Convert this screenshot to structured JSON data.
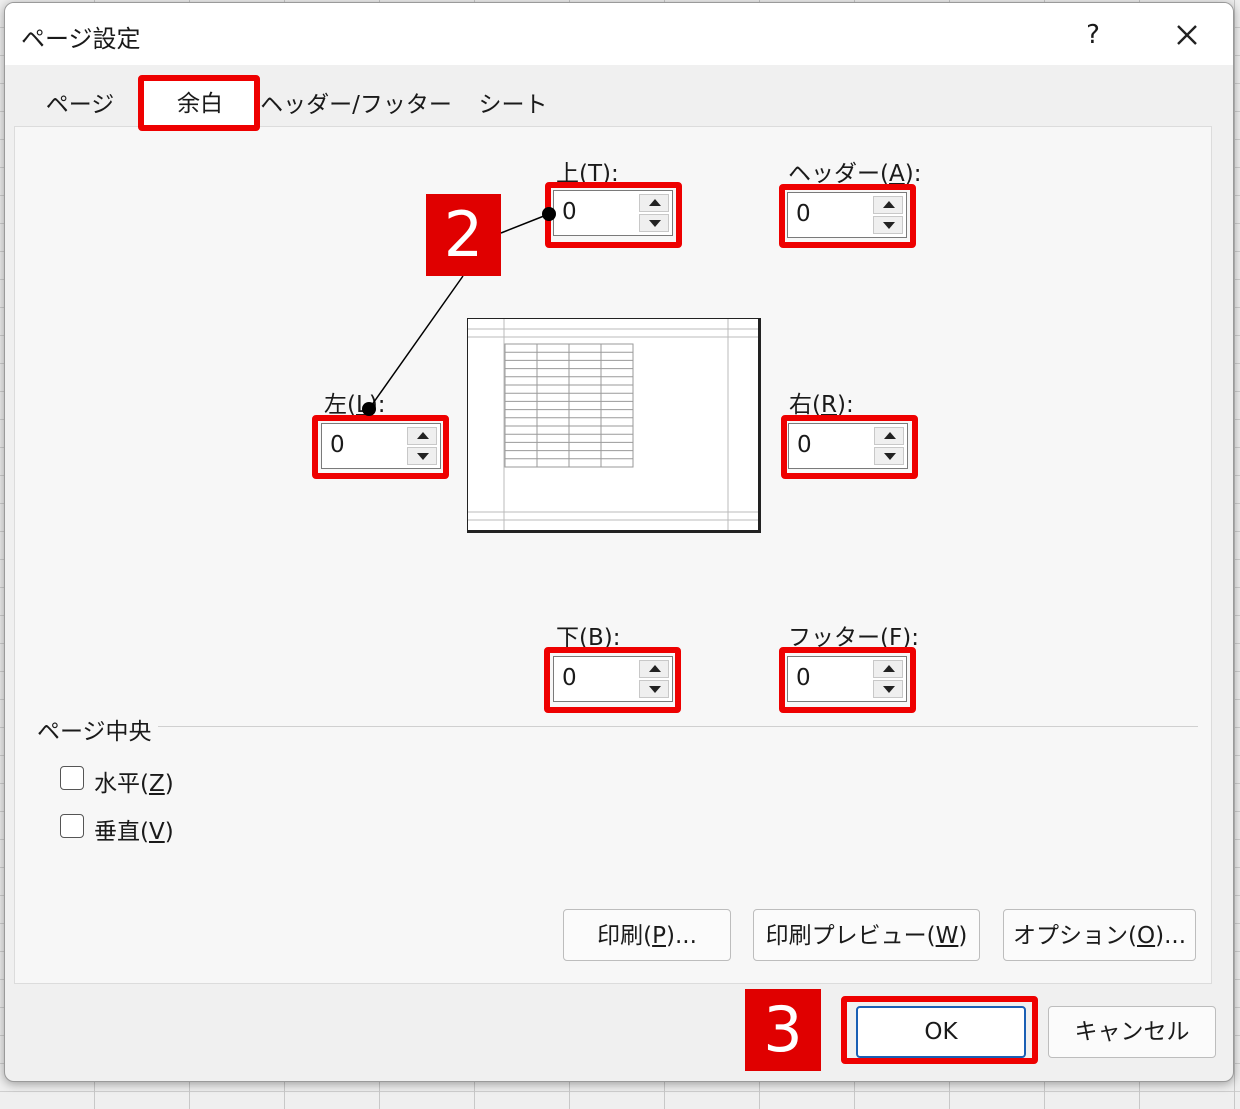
{
  "dialog": {
    "title": "ページ設定",
    "help_label": "?"
  },
  "tabs": [
    {
      "label": "ページ"
    },
    {
      "label": "余白"
    },
    {
      "label": "ヘッダー/フッター"
    },
    {
      "label": "シート"
    }
  ],
  "active_tab": "余白",
  "margins": {
    "top": {
      "label_pre": "上(",
      "accel": "T",
      "label_post": "):",
      "value": "0"
    },
    "header": {
      "label_pre": "ヘッダー(",
      "accel": "A",
      "label_post": "):",
      "value": "0"
    },
    "left": {
      "label_pre": "左(",
      "accel": "L",
      "label_post": "):",
      "value": "0"
    },
    "right": {
      "label_pre": "右(",
      "accel": "R",
      "label_post": "):",
      "value": "0"
    },
    "bottom": {
      "label_pre": "下(",
      "accel": "B",
      "label_post": "):",
      "value": "0"
    },
    "footer": {
      "label_pre": "フッター(",
      "accel": "F",
      "label_post": "):",
      "value": "0"
    }
  },
  "center_on_page": {
    "heading": "ページ中央",
    "horizontal": {
      "label_pre": "水平(",
      "accel": "Z",
      "label_post": ")",
      "checked": false
    },
    "vertical": {
      "label_pre": "垂直(",
      "accel": "V",
      "label_post": ")",
      "checked": false
    }
  },
  "buttons": {
    "print": {
      "label_pre": "印刷(",
      "accel": "P",
      "label_post": ")..."
    },
    "print_preview": {
      "label_pre": "印刷プレビュー(",
      "accel": "W",
      "label_post": ")"
    },
    "options": {
      "label_pre": "オプション(",
      "accel": "O",
      "label_post": ")..."
    },
    "ok": "OK",
    "cancel": "キャンセル"
  },
  "annotations": {
    "step2": "2",
    "step3": "3",
    "highlight_color": "#ee0000"
  }
}
